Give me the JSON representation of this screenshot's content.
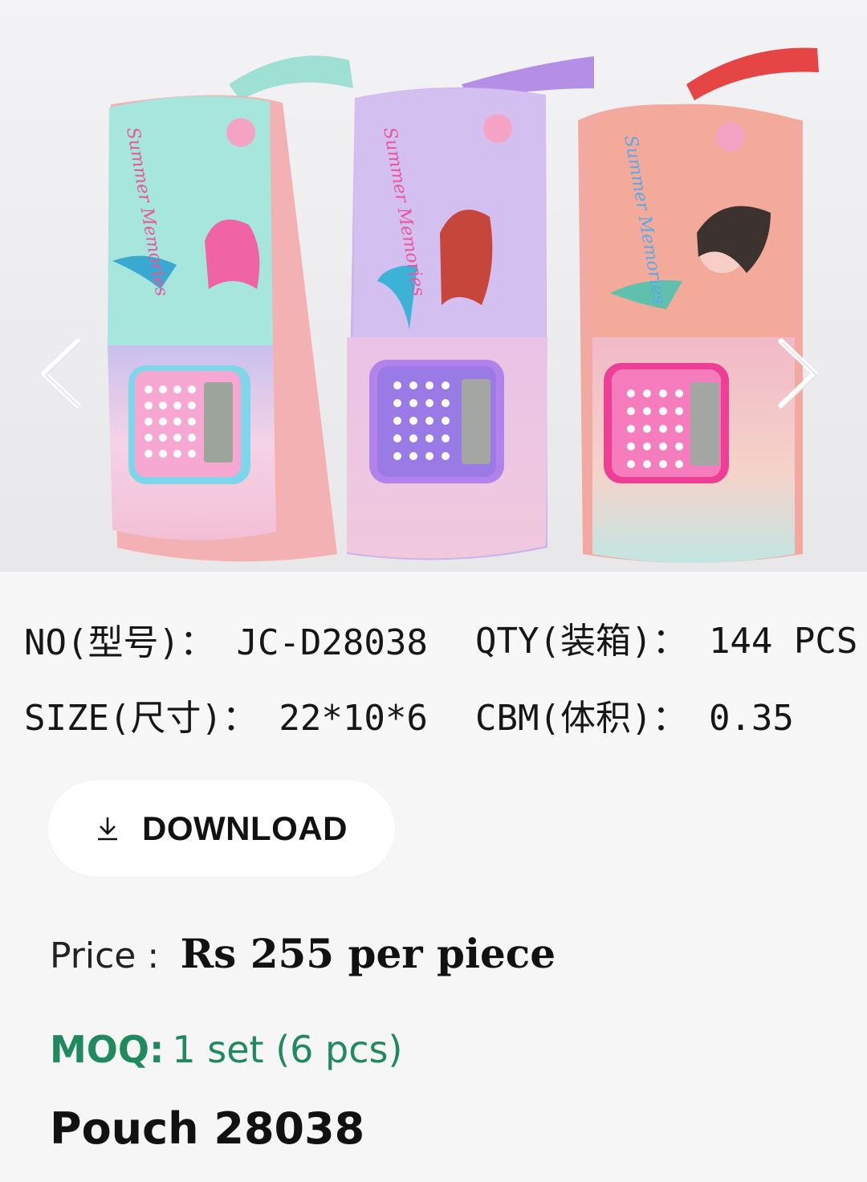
{
  "carousel": {
    "image": "Three mermaid pencil pouches with calculators",
    "print_text": "Summer Memories",
    "prev_icon": "chevron-left-icon",
    "next_icon": "chevron-right-icon",
    "pouch_colors": [
      "#9fe0da",
      "#cbb2ee",
      "#f3a99c"
    ]
  },
  "specs": {
    "no": "NO(型号)： JC-D28038",
    "qty": "QTY(装箱)： 144 PCS",
    "size": "SIZE(尺寸)： 22*10*6",
    "cbm": "CBM(体积)： 0.35"
  },
  "download": {
    "label": "DOWNLOAD",
    "icon": "download-icon"
  },
  "price": {
    "label": "Price :",
    "value": "Rs 255 per piece"
  },
  "moq": {
    "label": "MOQ:",
    "value": "1 set (6 pcs)",
    "color": "#1e8a5e"
  },
  "product": {
    "name": "Pouch 28038"
  }
}
